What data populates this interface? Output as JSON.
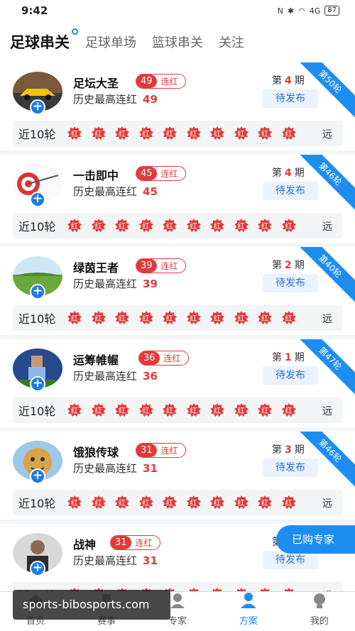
{
  "status_bar": {
    "time": "9:42",
    "battery": "87",
    "signal": "4G"
  },
  "tabs": [
    {
      "label": "足球串关",
      "active": true
    },
    {
      "label": "足球单场",
      "active": false
    },
    {
      "label": "篮球串关",
      "active": false
    },
    {
      "label": "关注",
      "active": false
    }
  ],
  "labels": {
    "streak": "连红",
    "history_prefix": "历史最高连红",
    "period_prefix": "第",
    "period_suffix": "期",
    "pending": "待发布",
    "recent": "近10轮",
    "far": "远",
    "result_badge": "红",
    "follow": "+"
  },
  "experts": [
    {
      "name": "足坛大圣",
      "streak": "49",
      "history": "49",
      "period": "4",
      "round": "第50轮",
      "avatar": "car"
    },
    {
      "name": "一击即中",
      "streak": "45",
      "history": "45",
      "period": "4",
      "round": "第46轮",
      "avatar": "target"
    },
    {
      "name": "绿茵王者",
      "streak": "39",
      "history": "39",
      "period": "2",
      "round": "第40轮",
      "avatar": "field"
    },
    {
      "name": "运筹帷幄",
      "streak": "36",
      "history": "36",
      "period": "1",
      "round": "第47轮",
      "avatar": "player"
    },
    {
      "name": "饿狼传球",
      "streak": "31",
      "history": "31",
      "period": "3",
      "round": "第46轮",
      "avatar": "mask"
    },
    {
      "name": "战神",
      "streak": "31",
      "history": "31",
      "period": "",
      "round": "",
      "avatar": "person"
    }
  ],
  "floating_button": "已购专家",
  "bottom_nav": [
    {
      "label": "首页",
      "icon": "home-icon",
      "active": false
    },
    {
      "label": "赛事",
      "icon": "trophy-icon",
      "active": false
    },
    {
      "label": "专家",
      "icon": "expert-icon",
      "active": false
    },
    {
      "label": "方案",
      "icon": "plan-icon",
      "active": true
    },
    {
      "label": "我的",
      "icon": "profile-icon",
      "active": false
    }
  ],
  "watermark": "sports-bibosports.com",
  "colors": {
    "accent": "#1e8df0",
    "red": "#e03a3a"
  }
}
